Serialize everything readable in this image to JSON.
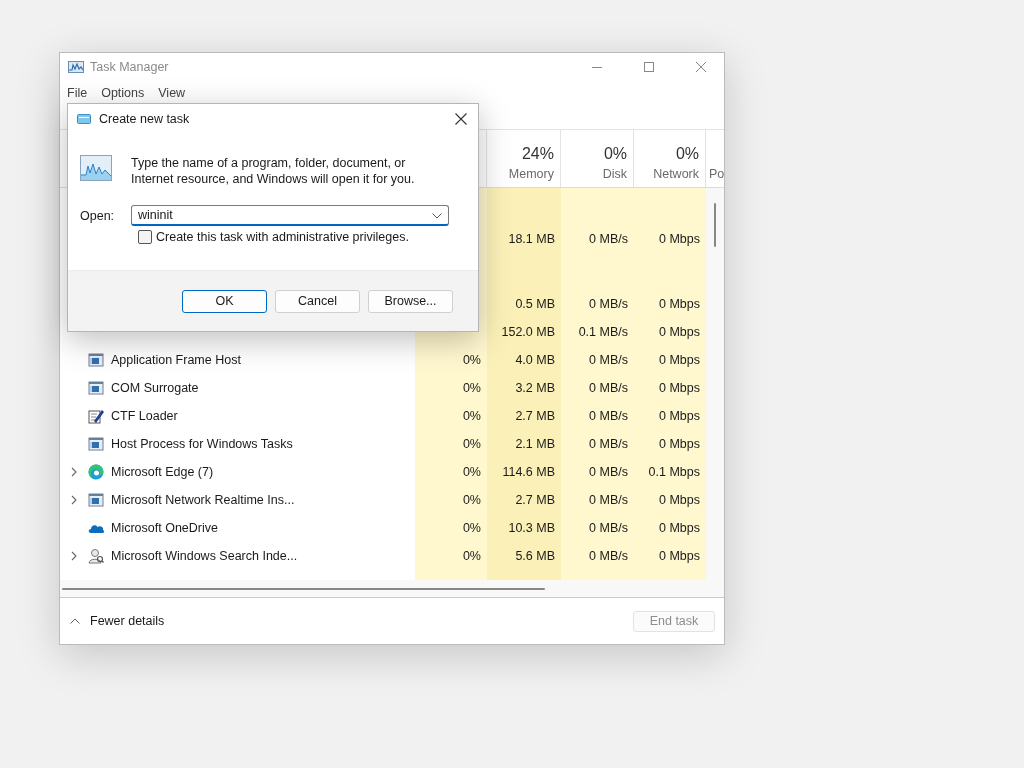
{
  "task_manager": {
    "title": "Task Manager",
    "menu": [
      "File",
      "Options",
      "View"
    ],
    "columns": [
      {
        "percent": "24%",
        "label": "Memory"
      },
      {
        "percent": "0%",
        "label": "Disk"
      },
      {
        "percent": "0%",
        "label": "Network"
      },
      {
        "label": "Po"
      }
    ],
    "rows": [
      {
        "kind": "group"
      },
      {
        "kind": "process",
        "memory": "18.1 MB",
        "disk": "0 MB/s",
        "network": "0 Mbps"
      },
      {
        "kind": "group"
      },
      {
        "kind": "process",
        "memory": "0.5 MB",
        "disk": "0 MB/s",
        "network": "0 Mbps"
      },
      {
        "kind": "process",
        "memory": "152.0 MB",
        "disk": "0.1 MB/s",
        "network": "0 Mbps"
      },
      {
        "kind": "app",
        "expandable": false,
        "name": "Application Frame Host",
        "cpu": "0%",
        "memory": "4.0 MB",
        "disk": "0 MB/s",
        "network": "0 Mbps"
      },
      {
        "kind": "app",
        "expandable": false,
        "name": "COM Surrogate",
        "cpu": "0%",
        "memory": "3.2 MB",
        "disk": "0 MB/s",
        "network": "0 Mbps"
      },
      {
        "kind": "pen",
        "expandable": false,
        "name": "CTF Loader",
        "cpu": "0%",
        "memory": "2.7 MB",
        "disk": "0 MB/s",
        "network": "0 Mbps"
      },
      {
        "kind": "app",
        "expandable": false,
        "name": "Host Process for Windows Tasks",
        "cpu": "0%",
        "memory": "2.1 MB",
        "disk": "0 MB/s",
        "network": "0 Mbps"
      },
      {
        "kind": "edge",
        "expandable": true,
        "name": "Microsoft Edge (7)",
        "cpu": "0%",
        "memory": "114.6 MB",
        "disk": "0 MB/s",
        "network": "0.1 Mbps"
      },
      {
        "kind": "app",
        "expandable": true,
        "name": "Microsoft Network Realtime Ins...",
        "cpu": "0%",
        "memory": "2.7 MB",
        "disk": "0 MB/s",
        "network": "0 Mbps"
      },
      {
        "kind": "cloud",
        "expandable": false,
        "name": "Microsoft OneDrive",
        "cpu": "0%",
        "memory": "10.3 MB",
        "disk": "0 MB/s",
        "network": "0 Mbps"
      },
      {
        "kind": "person",
        "expandable": true,
        "name": "Microsoft Windows Search Inde...",
        "cpu": "0%",
        "memory": "5.6 MB",
        "disk": "0 MB/s",
        "network": "0 Mbps"
      }
    ],
    "footer": {
      "toggle": "Fewer details",
      "end_task": {
        "label": "End task",
        "disabled": true
      }
    }
  },
  "dialog": {
    "title": "Create new task",
    "message": "Type the name of a program, folder, document, or Internet resource, and Windows will open it for you.",
    "open_label": "Open:",
    "open_value": "wininit",
    "admin_checkbox": {
      "label": "Create this task with administrative privileges.",
      "checked": false
    },
    "buttons": [
      {
        "label": "OK",
        "selected": true
      },
      {
        "label": "Cancel",
        "selected": false
      },
      {
        "label": "Browse...",
        "selected": false
      }
    ]
  }
}
